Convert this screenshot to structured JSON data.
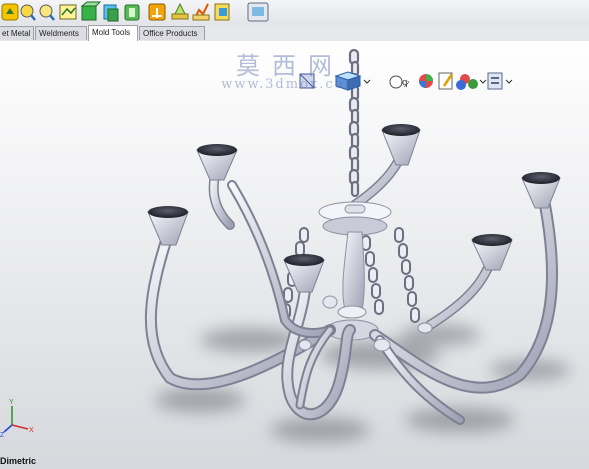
{
  "toolbar": {
    "icons": [
      "rebuild-icon",
      "zoom-fit-icon",
      "zoom-area-icon",
      "sketch-icon",
      "extrude-icon",
      "cut-icon",
      "part-icon",
      "assembly-icon",
      "surface-icon",
      "feature-icon",
      "weld-icon",
      "drawing-icon"
    ],
    "accent": "#e8a000"
  },
  "tabs": [
    {
      "label": "et Metal",
      "active": false
    },
    {
      "label": "Weldments",
      "active": false
    },
    {
      "label": "Mold Tools",
      "active": true
    },
    {
      "label": "Office Products",
      "active": false
    }
  ],
  "heads_up": {
    "icons": [
      "section-view-icon",
      "view-orientation-icon",
      "display-style-icon",
      "hide-show-icon",
      "edit-appearance-icon",
      "apply-scene-icon",
      "view-settings-icon"
    ]
  },
  "watermark": {
    "chinese": "莫西网",
    "url": "www.3dmox.com"
  },
  "viewport": {
    "view_name": "Dimetric"
  },
  "triad": {
    "x_label": "X",
    "y_label": "Y",
    "z_label": "Z"
  }
}
